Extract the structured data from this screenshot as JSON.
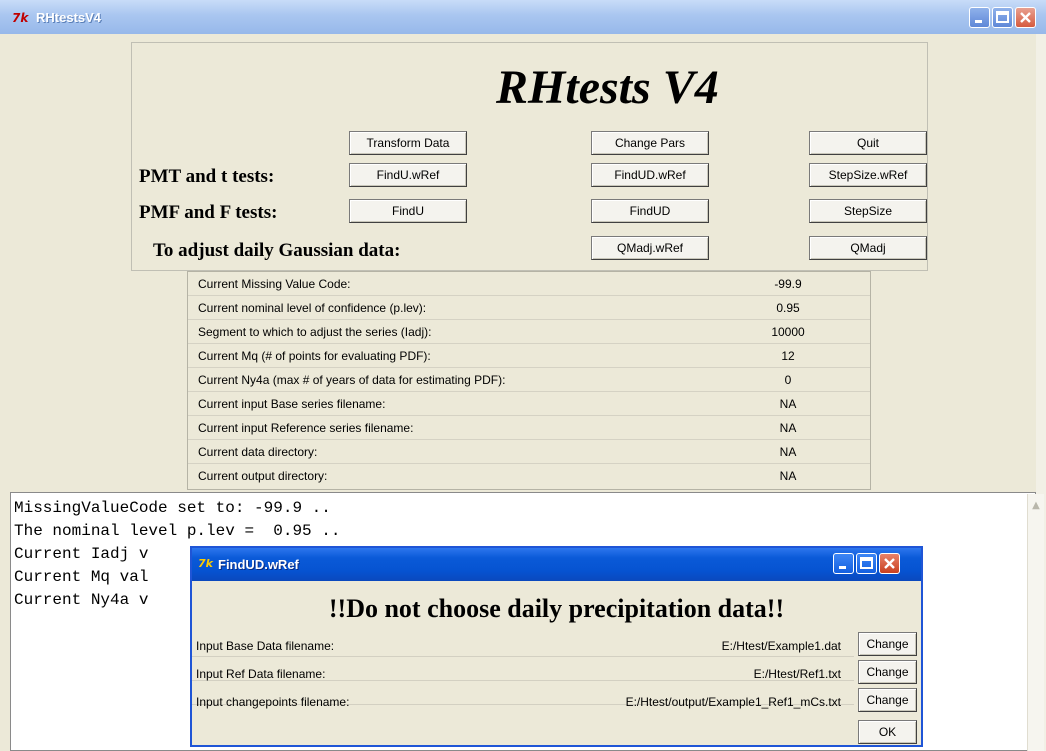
{
  "window": {
    "title": "RHtestsV4",
    "icon_text": "7k"
  },
  "header": {
    "app_title": "RHtests V4",
    "row_labels": {
      "pmt": "PMT and t tests:",
      "pmf": "PMF and F tests:",
      "adjust": "To adjust daily  Gaussian data:"
    },
    "buttons": {
      "transform_data": "Transform Data",
      "change_pars": "Change Pars",
      "quit": "Quit",
      "findu_wref": "FindU.wRef",
      "findud_wref": "FindUD.wRef",
      "stepsize_wref": "StepSize.wRef",
      "findu": "FindU",
      "findud": "FindUD",
      "stepsize": "StepSize",
      "qmadj_wref": "QMadj.wRef",
      "qmadj": "QMadj"
    }
  },
  "info": {
    "rows": [
      {
        "label": "Current Missing Value Code:",
        "value": "-99.9"
      },
      {
        "label": "Current nominal level of confidence (p.lev):",
        "value": "0.95"
      },
      {
        "label": "Segment to which to adjust the series (Iadj):",
        "value": "10000"
      },
      {
        "label": "Current Mq (# of points for evaluating PDF):",
        "value": "12"
      },
      {
        "label": "Current Ny4a (max # of years of data for estimating PDF):",
        "value": "0"
      },
      {
        "label": "Current input Base series filename:",
        "value": "NA"
      },
      {
        "label": "Current input Reference series filename:",
        "value": "NA"
      },
      {
        "label": "Current data directory:",
        "value": "NA"
      },
      {
        "label": "Current output directory:",
        "value": "NA"
      }
    ]
  },
  "console": {
    "lines": [
      "MissingValueCode set to: -99.9 ..",
      "The nominal level p.lev =  0.95 ..",
      "Current Iadj v",
      "Current Mq val",
      "Current Ny4a v"
    ]
  },
  "dialog": {
    "title": "FindUD.wRef",
    "icon_text": "7k",
    "warning": "!!Do not choose daily precipitation data!!",
    "rows": [
      {
        "label": "Input Base Data filename:",
        "value": "E:/Htest/Example1.dat",
        "button": "Change"
      },
      {
        "label": "Input Ref Data filename:",
        "value": "E:/Htest/Ref1.txt",
        "button": "Change"
      },
      {
        "label": "Input changepoints filename:",
        "value": "E:/Htest/output/Example1_Ref1_mCs.txt",
        "button": "Change"
      }
    ],
    "ok_label": "OK"
  },
  "colors": {
    "window_bg": "#ece9d8",
    "title_active": "#0653d1",
    "title_inactive": "#a9c6f0",
    "close_red": "#d65b3f"
  }
}
